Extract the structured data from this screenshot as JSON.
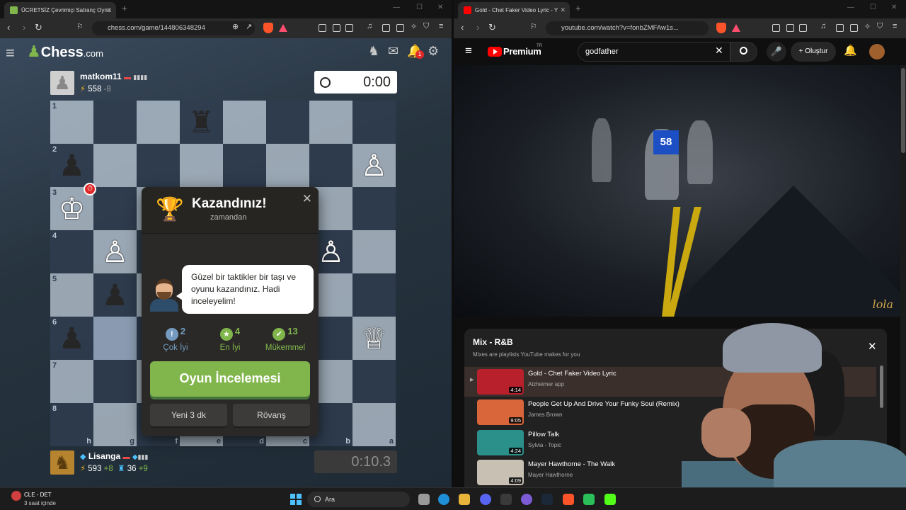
{
  "left_browser": {
    "tab_title": "ÜCRETSİZ Çevrimiçi Satranç Oyna",
    "url": "chess.com/game/144806348294"
  },
  "right_browser": {
    "tab_title": "Gold - Chet Faker Video Lyric - Y",
    "url": "youtube.com/watch?v=fonbZMFAw1s..."
  },
  "chess": {
    "logo_text": "Chess",
    "logo_domain": ".com",
    "notification_count": "1",
    "top_player": {
      "name": "matkom11",
      "rating": "558",
      "rating_change": "-8",
      "clock": "0:00"
    },
    "bottom_player": {
      "name": "Lisanga",
      "rating": "593",
      "rating_change": "+8",
      "puzzle_rating": "36",
      "puzzle_change": "+9",
      "clock": "0:10.3"
    },
    "ranks": [
      "1",
      "2",
      "3",
      "4",
      "5",
      "6",
      "7",
      "8"
    ],
    "files": [
      "h",
      "g",
      "f",
      "e",
      "d",
      "c",
      "b",
      "a"
    ],
    "modal": {
      "title": "Kazandınız!",
      "subtitle": "zamandan",
      "coach_message": "Güzel bir taktikler bir taşı ve oyunu kazandınız. Hadi inceleyelim!",
      "stats": [
        {
          "count": "2",
          "label": "Çok İyi",
          "color": "#749bbf",
          "icon": "!"
        },
        {
          "count": "4",
          "label": "En İyi",
          "color": "#81b64c",
          "icon": "★"
        },
        {
          "count": "13",
          "label": "Mükemmel",
          "color": "#81b64c",
          "icon": "👍"
        }
      ],
      "review_button": "Oyun İncelemesi",
      "new_game_button": "Yeni 3 dk",
      "rematch_button": "Rövanş"
    }
  },
  "youtube": {
    "brand": "Premium",
    "country": "TR",
    "search_value": "godfather",
    "create_label": "Oluştur",
    "watermark": "lola",
    "video_jersey_number": "58",
    "mix": {
      "title": "Mix - R&B",
      "subtitle": "Mixes are playlists YouTube makes for you",
      "items": [
        {
          "title": "Gold - Chet Faker Video Lyric",
          "channel": "Alzheimer app",
          "duration": "4:14",
          "thumb_color": "#b8202b"
        },
        {
          "title": "People Get Up And Drive Your Funky Soul (Remix)",
          "channel": "James Brown",
          "duration": "9:05",
          "thumb_color": "#d9653a"
        },
        {
          "title": "Pillow Talk",
          "channel": "Sylvia - Topic",
          "duration": "4:24",
          "thumb_color": "#2b8f8a"
        },
        {
          "title": "Mayer Hawthorne - The Walk",
          "channel": "Mayer Hawthorne",
          "duration": "4:09",
          "thumb_color": "#c7c0b3"
        }
      ]
    }
  },
  "taskbar": {
    "weather_line1": "CLE - DET",
    "weather_line2": "3 saat içinde",
    "search_placeholder": "Ara"
  },
  "colors": {
    "chess_green": "#81b64c",
    "youtube_red": "#ff0000",
    "trophy_gold": "#f1b51f"
  }
}
